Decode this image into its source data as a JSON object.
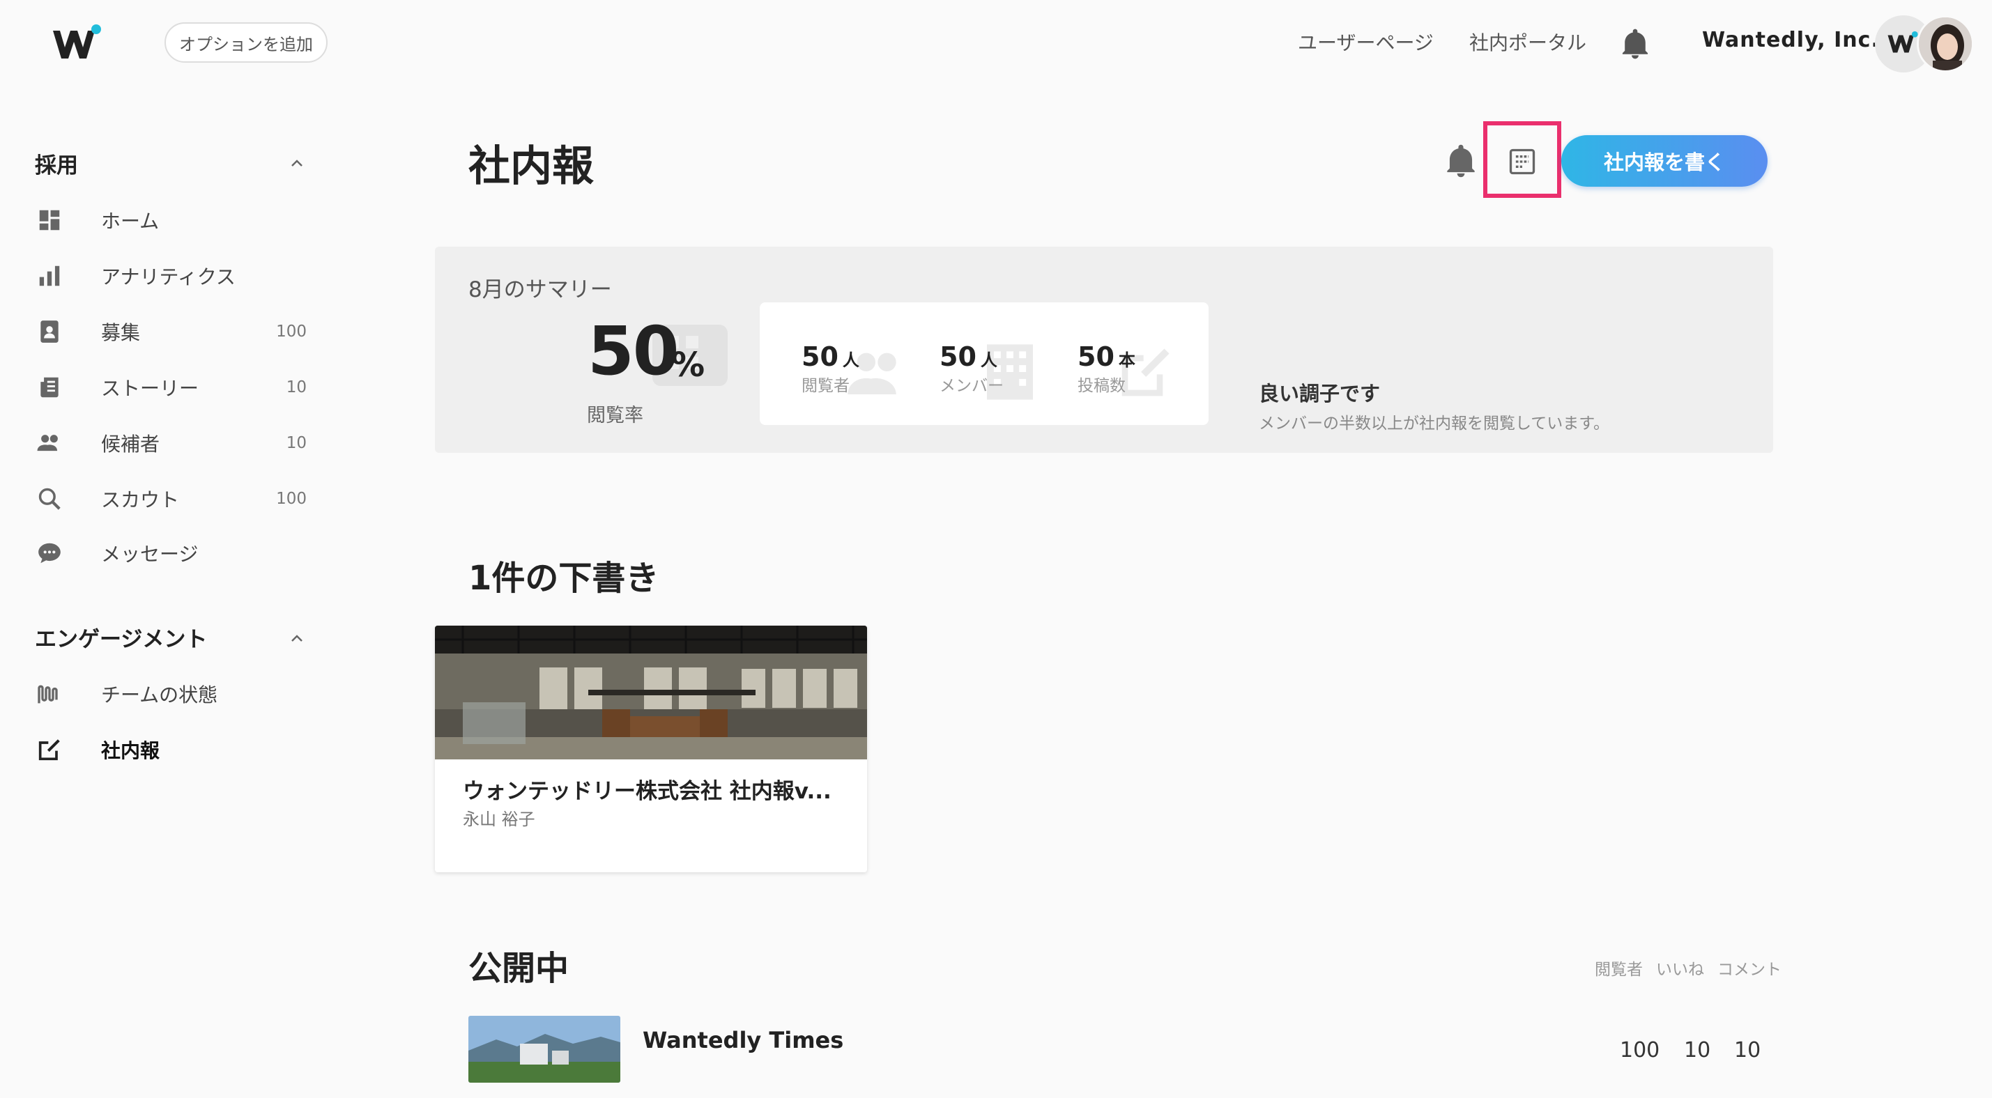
{
  "topbar": {
    "add_option": "オプションを追加",
    "links": [
      "ユーザーページ",
      "社内ポータル"
    ],
    "company": "Wantedly, Inc."
  },
  "sidebar": {
    "recruit_title": "採用",
    "recruit_items": [
      {
        "label": "ホーム",
        "count": "",
        "icon": "dashboard-icon"
      },
      {
        "label": "アナリティクス",
        "count": "",
        "icon": "bar-chart-icon"
      },
      {
        "label": "募集",
        "count": "100",
        "icon": "recruit-badge-icon"
      },
      {
        "label": "ストーリー",
        "count": "10",
        "icon": "story-icon"
      },
      {
        "label": "候補者",
        "count": "10",
        "icon": "people-icon"
      },
      {
        "label": "スカウト",
        "count": "100",
        "icon": "search-icon"
      },
      {
        "label": "メッセージ",
        "count": "",
        "icon": "message-icon"
      }
    ],
    "engagement_title": "エンゲージメント",
    "engagement_items": [
      {
        "label": "チームの状態",
        "icon": "wave-icon"
      },
      {
        "label": "社内報",
        "icon": "edit-icon"
      }
    ]
  },
  "main": {
    "title": "社内報",
    "write_button": "社内報を書く",
    "summary": {
      "title": "8月のサマリー",
      "rate_value": "50",
      "rate_unit": "%",
      "rate_label": "閲覧率",
      "stats": [
        {
          "value": "50",
          "unit": "人",
          "label": "閲覧者"
        },
        {
          "value": "50",
          "unit": "人",
          "label": "メンバー"
        },
        {
          "value": "50",
          "unit": "本",
          "label": "投稿数"
        }
      ],
      "status_title": "良い調子です",
      "status_desc": "メンバーの半数以上が社内報を閲覧しています。"
    },
    "drafts": {
      "heading": "1件の下書き",
      "items": [
        {
          "title": "ウォンテッドリー株式会社 社内報v...",
          "author": "永山 裕子"
        }
      ]
    },
    "published": {
      "heading": "公開中",
      "columns": [
        "閲覧者",
        "いいね",
        "コメント"
      ],
      "items": [
        {
          "title": "Wantedly Times",
          "viewers": "100",
          "likes": "10",
          "comments": "10"
        }
      ]
    }
  }
}
